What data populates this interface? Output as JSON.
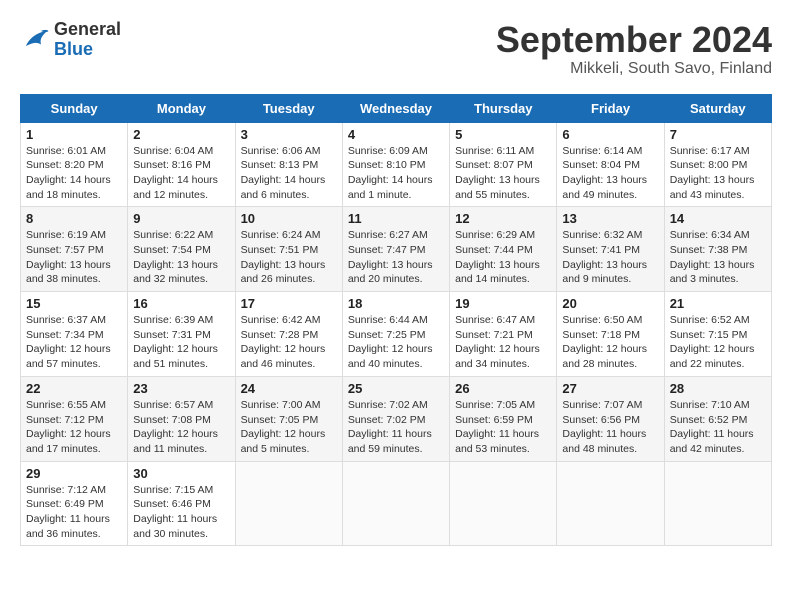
{
  "header": {
    "logo_general": "General",
    "logo_blue": "Blue",
    "main_title": "September 2024",
    "subtitle": "Mikkeli, South Savo, Finland"
  },
  "calendar": {
    "days_of_week": [
      "Sunday",
      "Monday",
      "Tuesday",
      "Wednesday",
      "Thursday",
      "Friday",
      "Saturday"
    ],
    "weeks": [
      [
        {
          "day": "1",
          "info": "Sunrise: 6:01 AM\nSunset: 8:20 PM\nDaylight: 14 hours\nand 18 minutes."
        },
        {
          "day": "2",
          "info": "Sunrise: 6:04 AM\nSunset: 8:16 PM\nDaylight: 14 hours\nand 12 minutes."
        },
        {
          "day": "3",
          "info": "Sunrise: 6:06 AM\nSunset: 8:13 PM\nDaylight: 14 hours\nand 6 minutes."
        },
        {
          "day": "4",
          "info": "Sunrise: 6:09 AM\nSunset: 8:10 PM\nDaylight: 14 hours\nand 1 minute."
        },
        {
          "day": "5",
          "info": "Sunrise: 6:11 AM\nSunset: 8:07 PM\nDaylight: 13 hours\nand 55 minutes."
        },
        {
          "day": "6",
          "info": "Sunrise: 6:14 AM\nSunset: 8:04 PM\nDaylight: 13 hours\nand 49 minutes."
        },
        {
          "day": "7",
          "info": "Sunrise: 6:17 AM\nSunset: 8:00 PM\nDaylight: 13 hours\nand 43 minutes."
        }
      ],
      [
        {
          "day": "8",
          "info": "Sunrise: 6:19 AM\nSunset: 7:57 PM\nDaylight: 13 hours\nand 38 minutes."
        },
        {
          "day": "9",
          "info": "Sunrise: 6:22 AM\nSunset: 7:54 PM\nDaylight: 13 hours\nand 32 minutes."
        },
        {
          "day": "10",
          "info": "Sunrise: 6:24 AM\nSunset: 7:51 PM\nDaylight: 13 hours\nand 26 minutes."
        },
        {
          "day": "11",
          "info": "Sunrise: 6:27 AM\nSunset: 7:47 PM\nDaylight: 13 hours\nand 20 minutes."
        },
        {
          "day": "12",
          "info": "Sunrise: 6:29 AM\nSunset: 7:44 PM\nDaylight: 13 hours\nand 14 minutes."
        },
        {
          "day": "13",
          "info": "Sunrise: 6:32 AM\nSunset: 7:41 PM\nDaylight: 13 hours\nand 9 minutes."
        },
        {
          "day": "14",
          "info": "Sunrise: 6:34 AM\nSunset: 7:38 PM\nDaylight: 13 hours\nand 3 minutes."
        }
      ],
      [
        {
          "day": "15",
          "info": "Sunrise: 6:37 AM\nSunset: 7:34 PM\nDaylight: 12 hours\nand 57 minutes."
        },
        {
          "day": "16",
          "info": "Sunrise: 6:39 AM\nSunset: 7:31 PM\nDaylight: 12 hours\nand 51 minutes."
        },
        {
          "day": "17",
          "info": "Sunrise: 6:42 AM\nSunset: 7:28 PM\nDaylight: 12 hours\nand 46 minutes."
        },
        {
          "day": "18",
          "info": "Sunrise: 6:44 AM\nSunset: 7:25 PM\nDaylight: 12 hours\nand 40 minutes."
        },
        {
          "day": "19",
          "info": "Sunrise: 6:47 AM\nSunset: 7:21 PM\nDaylight: 12 hours\nand 34 minutes."
        },
        {
          "day": "20",
          "info": "Sunrise: 6:50 AM\nSunset: 7:18 PM\nDaylight: 12 hours\nand 28 minutes."
        },
        {
          "day": "21",
          "info": "Sunrise: 6:52 AM\nSunset: 7:15 PM\nDaylight: 12 hours\nand 22 minutes."
        }
      ],
      [
        {
          "day": "22",
          "info": "Sunrise: 6:55 AM\nSunset: 7:12 PM\nDaylight: 12 hours\nand 17 minutes."
        },
        {
          "day": "23",
          "info": "Sunrise: 6:57 AM\nSunset: 7:08 PM\nDaylight: 12 hours\nand 11 minutes."
        },
        {
          "day": "24",
          "info": "Sunrise: 7:00 AM\nSunset: 7:05 PM\nDaylight: 12 hours\nand 5 minutes."
        },
        {
          "day": "25",
          "info": "Sunrise: 7:02 AM\nSunset: 7:02 PM\nDaylight: 11 hours\nand 59 minutes."
        },
        {
          "day": "26",
          "info": "Sunrise: 7:05 AM\nSunset: 6:59 PM\nDaylight: 11 hours\nand 53 minutes."
        },
        {
          "day": "27",
          "info": "Sunrise: 7:07 AM\nSunset: 6:56 PM\nDaylight: 11 hours\nand 48 minutes."
        },
        {
          "day": "28",
          "info": "Sunrise: 7:10 AM\nSunset: 6:52 PM\nDaylight: 11 hours\nand 42 minutes."
        }
      ],
      [
        {
          "day": "29",
          "info": "Sunrise: 7:12 AM\nSunset: 6:49 PM\nDaylight: 11 hours\nand 36 minutes."
        },
        {
          "day": "30",
          "info": "Sunrise: 7:15 AM\nSunset: 6:46 PM\nDaylight: 11 hours\nand 30 minutes."
        },
        {
          "day": "",
          "info": ""
        },
        {
          "day": "",
          "info": ""
        },
        {
          "day": "",
          "info": ""
        },
        {
          "day": "",
          "info": ""
        },
        {
          "day": "",
          "info": ""
        }
      ]
    ]
  }
}
